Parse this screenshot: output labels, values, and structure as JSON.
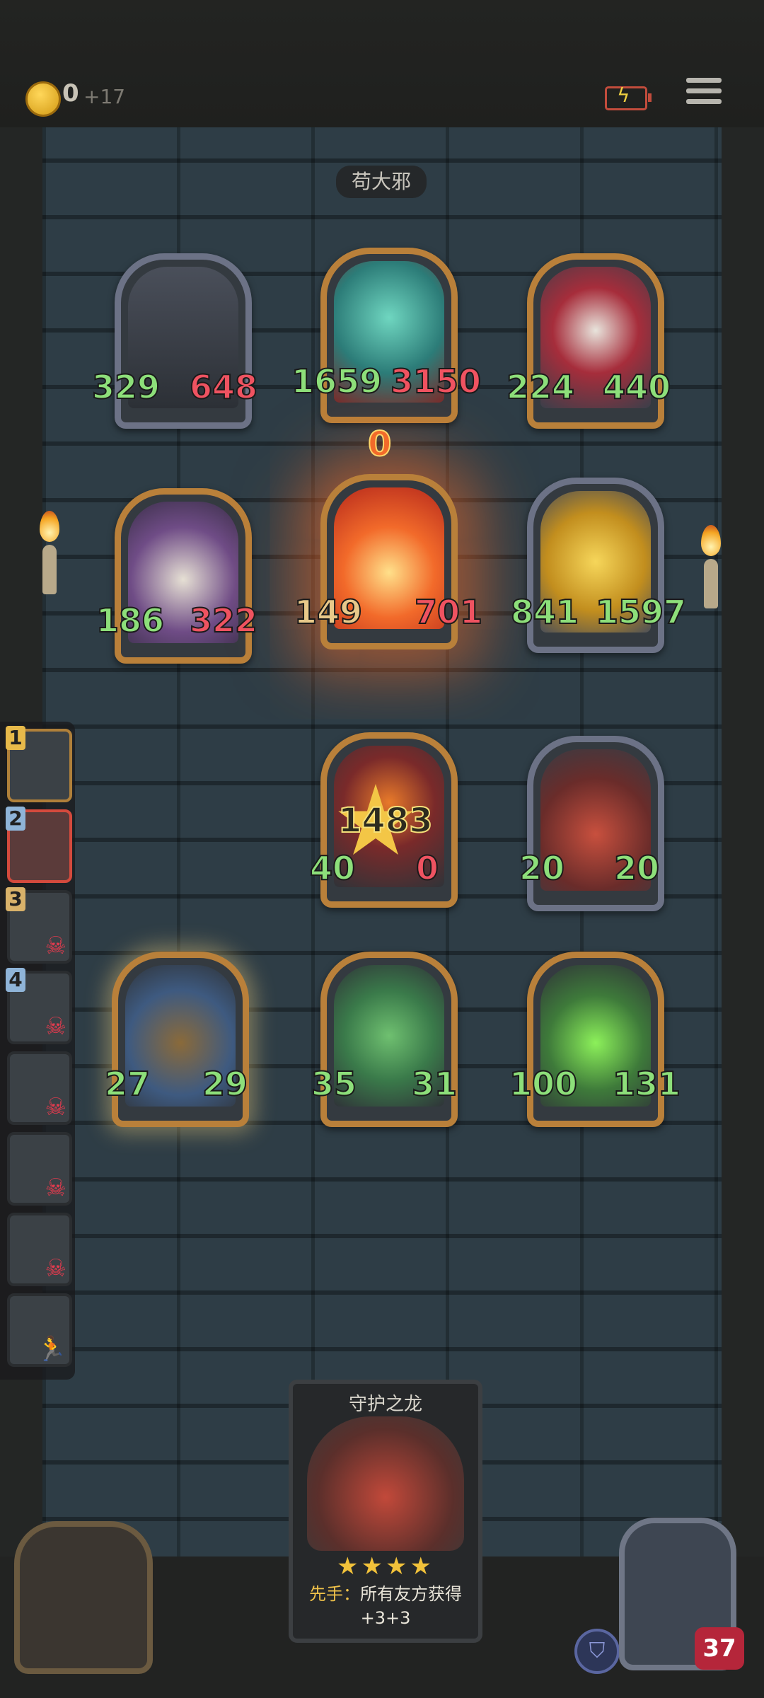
{
  "topbar": {
    "coins": "0",
    "coin_income": "+17",
    "battery_icon": "battery-charging-icon",
    "menu_icon": "menu-icon"
  },
  "enemy": {
    "name": "苟大邪",
    "cards": [
      {
        "atk": "329",
        "hp": "648"
      },
      {
        "atk": "1659",
        "hp": "3150"
      },
      {
        "atk": "224",
        "hp": "440"
      },
      {
        "atk": "186",
        "hp": "322"
      },
      {
        "atk": "149",
        "hp": "701",
        "timer": "0"
      },
      {
        "atk": "841",
        "hp": "1597"
      }
    ]
  },
  "player": {
    "cards": [
      {
        "atk": "40",
        "hp": "0",
        "damage": "1483"
      },
      {
        "atk": "20",
        "hp": "20"
      },
      {
        "atk": "27",
        "hp": "29"
      },
      {
        "atk": "35",
        "hp": "31"
      },
      {
        "atk": "100",
        "hp": "131"
      }
    ],
    "hero_health": "37"
  },
  "queue": {
    "numbers": [
      "1",
      "2",
      "3",
      "4"
    ]
  },
  "hand_card": {
    "title": "守护之龙",
    "stars": "★★★★",
    "desc_key": "先手：",
    "desc_line1": "所有友方获得",
    "desc_line2": "+3+3"
  },
  "colors": {
    "attack_green": "#8ddf7a",
    "health_red": "#ef5361",
    "gold_frame": "#b9803a",
    "steel_frame": "#6c7286"
  }
}
